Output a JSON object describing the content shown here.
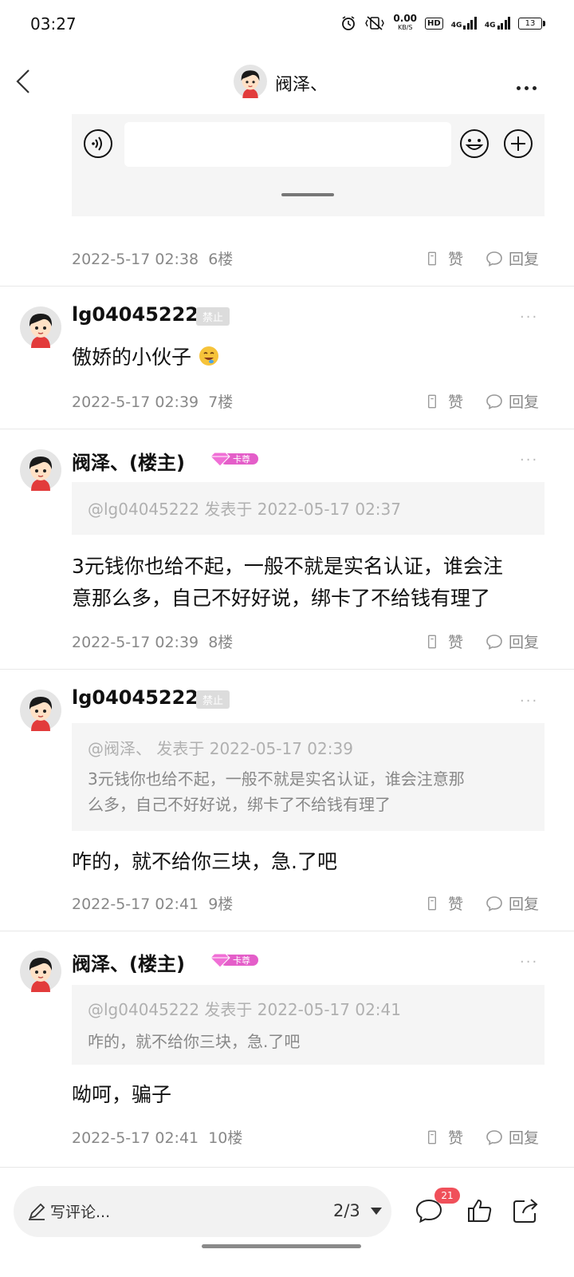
{
  "status_bar": {
    "time": "03:27",
    "speed_value": "0.00",
    "speed_unit": "KB/S",
    "hd_label": "HD",
    "net1": "4G",
    "net2": "4G",
    "battery": "13"
  },
  "header": {
    "title": "阀泽、",
    "back_icon": "chevron-left-icon",
    "more_icon": "more-horizontal-icon"
  },
  "input_panel": {
    "voice_icon": "voice-icon",
    "emoji_icon": "emoji-icon",
    "plus_icon": "plus-circle-icon",
    "placeholder": ""
  },
  "posts": [
    {
      "time": "2022-5-17 02:38",
      "floor": "6楼",
      "like": "赞",
      "reply": "回复"
    },
    {
      "user": "lg04045222",
      "badge": "禁止",
      "content": "傲娇的小伙子",
      "time": "2022-5-17 02:39",
      "floor": "7楼",
      "like": "赞",
      "reply": "回复"
    },
    {
      "user": "阀泽、(楼主)",
      "badge": "卡尊",
      "quote_head": "@lg04045222 发表于 2022-05-17 02:37",
      "content_line1": "3元钱你也给不起，一般不就是实名认证，谁会注",
      "content_line2": "意那么多，自己不好好说，绑卡了不给钱有理了",
      "time": "2022-5-17 02:39",
      "floor": "8楼",
      "like": "赞",
      "reply": "回复"
    },
    {
      "user": "lg04045222",
      "badge": "禁止",
      "quote_head": "@阀泽、 发表于 2022-05-17 02:39",
      "quote_line1": "3元钱你也给不起，一般不就是实名认证，谁会注意那",
      "quote_line2": "么多，自己不好好说，绑卡了不给钱有理了",
      "content": "咋的，就不给你三块，急.了吧",
      "time": "2022-5-17 02:41",
      "floor": "9楼",
      "like": "赞",
      "reply": "回复"
    },
    {
      "user": "阀泽、(楼主)",
      "badge": "卡尊",
      "quote_head": "@lg04045222 发表于 2022-05-17 02:41",
      "quote_line1": "咋的，就不给你三块，急.了吧",
      "content": "呦呵，骗子",
      "time": "2022-5-17 02:41",
      "floor": "10楼",
      "like": "赞",
      "reply": "回复"
    }
  ],
  "bottom_bar": {
    "comment_label": "写评论...",
    "page": "2/3",
    "comment_count": "21"
  },
  "colors": {
    "accent_pink": "#e45ec9",
    "badge_red": "#f0505a",
    "meta_gray": "#888888"
  }
}
